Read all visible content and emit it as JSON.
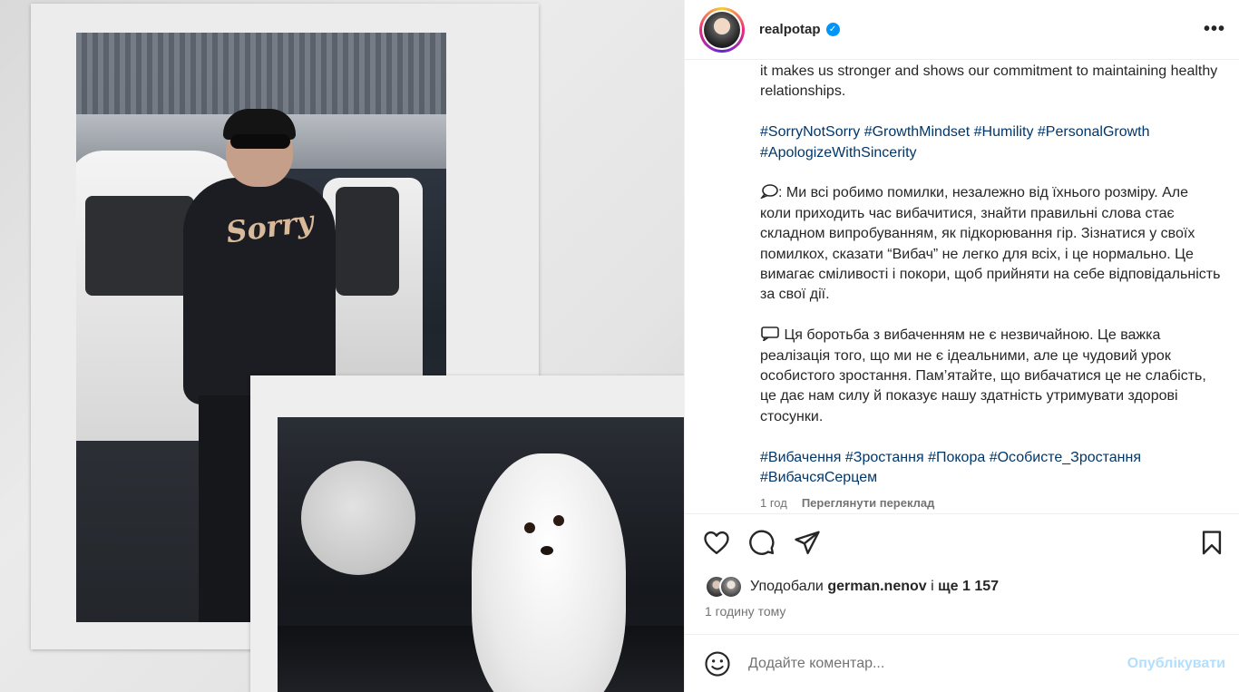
{
  "post": {
    "username": "realpotap",
    "verified_mark": "✓",
    "more_label": "•••"
  },
  "caption": {
    "line_top": "it makes us stronger and shows our commitment to maintaining healthy relationships.",
    "tags_en": [
      "#SorryNotSorry",
      "#GrowthMindset",
      "#Humility",
      "#PersonalGrowth",
      "#ApologizeWithSincerity"
    ],
    "para_ua_1": ": Ми всі робимо помилки, незалежно від їхнього розміру. Але коли приходить час вибачитися, знайти правильні слова стає складном випробуванням, як підкорювання гір. Зізнатися у своїх помилкох, сказати “Вибач” не легко для всіх, і це нормально. Це вимагає сміливості і покори, щоб прийняти на себе відповідальність за свої дії.",
    "para_ua_2": " Ця боротьба з вибаченням не є незвичайною. Це важка реалізація того, що ми не є ідеальними, але це чудовий урок особистого зростання. Пам’ятайте, що вибачатися це не слабість, це дає нам силу й показує нашу здатність утримувати здорові стосунки.",
    "tags_ua": [
      "#Вибачення",
      "#Зростання",
      "#Покора",
      "#Особисте_Зростання",
      "#ВибачсяСерцем"
    ]
  },
  "meta": {
    "age": "1 год",
    "translate_label": "Переглянути переклад"
  },
  "media": {
    "hoodie_text": "Sorry"
  },
  "likes": {
    "prefix": "Уподобали",
    "user": "german.nenov",
    "middle": "і",
    "rest": "ще 1 157"
  },
  "timestamp": "1 годину тому",
  "comment": {
    "placeholder": "Додайте коментар...",
    "publish_label": "Опублікувати"
  },
  "icons": {
    "like": "heart-icon",
    "comment": "comment-icon",
    "share": "share-icon",
    "save": "bookmark-icon",
    "emoji": "emoji-icon"
  },
  "colors": {
    "hashtag": "#00376b",
    "verified": "#0095f6",
    "publish_disabled": "#b2dffc",
    "muted": "#737373"
  }
}
